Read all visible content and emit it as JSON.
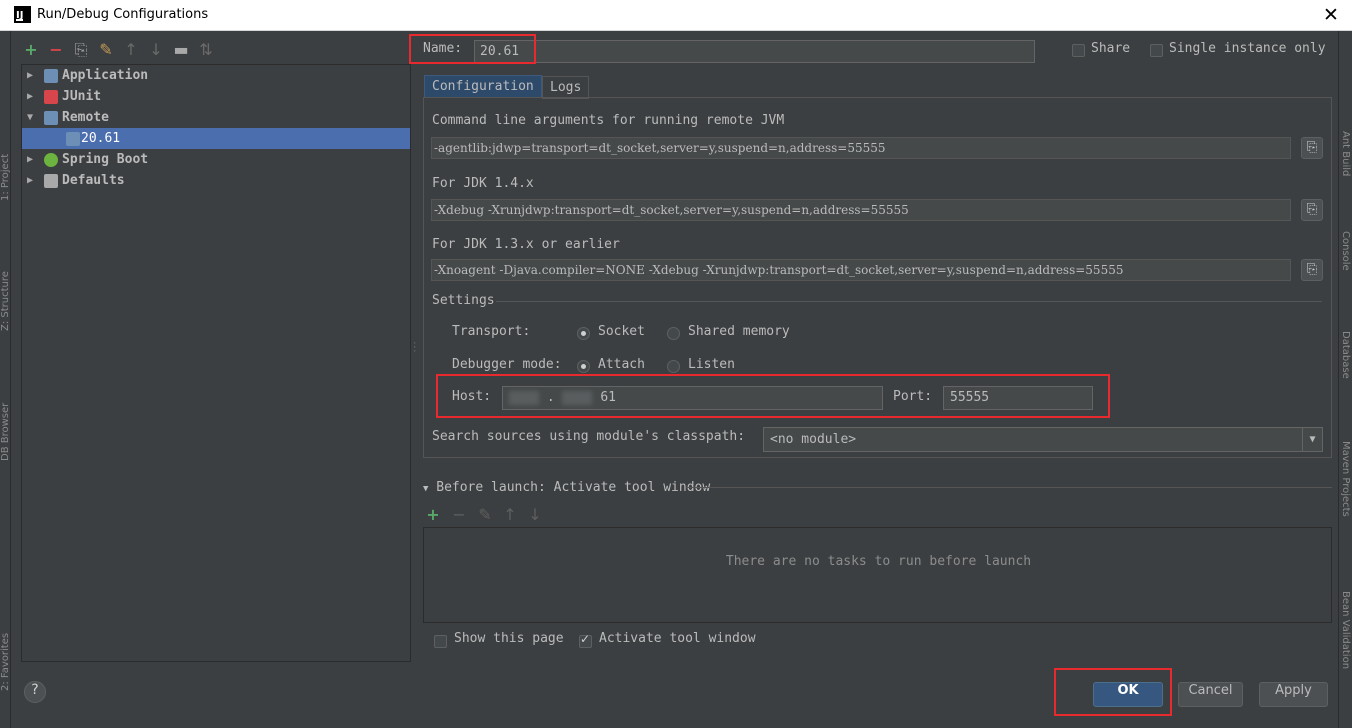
{
  "window": {
    "title": "Run/Debug Configurations",
    "app_icon_text": "IJ"
  },
  "side_strips": {
    "left": [
      "1: Project",
      "Z: Structure",
      "DB Browser",
      "2: Favorites"
    ],
    "right": [
      "Ant Build",
      "Console",
      "Database",
      "Maven Projects",
      "Bean Validation"
    ]
  },
  "tree": {
    "items": [
      {
        "label": "Application",
        "icon_color": "#6e8fb5"
      },
      {
        "label": "JUnit",
        "icon_color": "#d8454a"
      },
      {
        "label": "Remote",
        "icon_color": "#6e8fb5"
      },
      {
        "label": "20.61",
        "icon_color": "#6e8fb5"
      },
      {
        "label": "Spring Boot",
        "icon_color": "#6db33f"
      },
      {
        "label": "Defaults",
        "icon_color": "#a9a9a9"
      }
    ]
  },
  "name": {
    "label": "Name:",
    "value": "20.61"
  },
  "share_label": "Share",
  "single_instance_label": "Single instance only",
  "tabs": [
    "Configuration",
    "Logs"
  ],
  "config": {
    "cmd_label": "Command line arguments for running remote JVM",
    "cmd_value": "-agentlib:jdwp=transport=dt_socket,server=y,suspend=n,address=55555",
    "jdk14_label": "For JDK 1.4.x",
    "jdk14_value": "-Xdebug -Xrunjdwp:transport=dt_socket,server=y,suspend=n,address=55555",
    "jdk13_label": "For JDK 1.3.x or earlier",
    "jdk13_value": "-Xnoagent -Djava.compiler=NONE -Xdebug -Xrunjdwp:transport=dt_socket,server=y,suspend=n,address=55555",
    "settings_label": "Settings",
    "transport_label": "Transport:",
    "transport_options": [
      "Socket",
      "Shared memory"
    ],
    "debugger_label": "Debugger mode:",
    "debugger_options": [
      "Attach",
      "Listen"
    ],
    "host_label": "Host:",
    "host_value_visible": ".",
    "host_value_suffix": "61",
    "port_label": "Port:",
    "port_value": "55555",
    "classpath_label": "Search sources using module's classpath:",
    "classpath_value": "<no module>"
  },
  "before_launch": {
    "label": "Before launch: Activate tool window",
    "empty_text": "There are no tasks to run before launch"
  },
  "show_page_label": "Show this page",
  "activate_tool_label": "Activate tool window",
  "buttons": {
    "ok": "OK",
    "cancel": "Cancel",
    "apply": "Apply",
    "help": "?"
  },
  "colors": {
    "highlight": "#e8292d",
    "selection": "#4b6eaf",
    "primary_button": "#365880"
  }
}
